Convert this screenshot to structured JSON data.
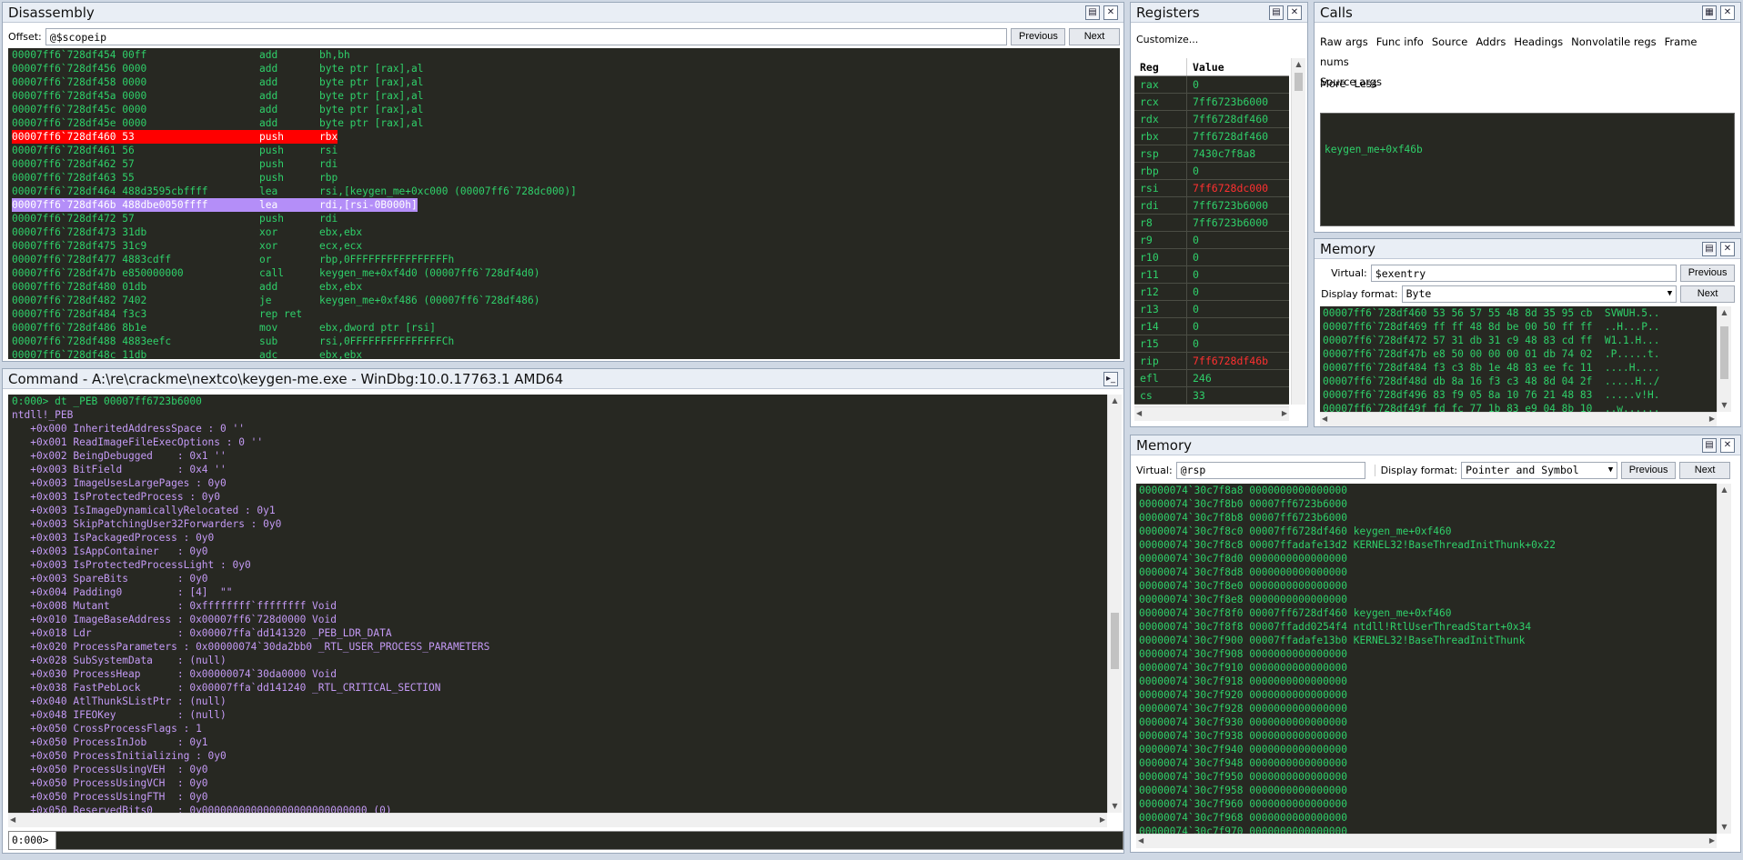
{
  "disassembly": {
    "title": "Disassembly",
    "offset_label": "Offset:",
    "offset_value": "@$scopeip",
    "prev": "Previous",
    "next": "Next",
    "lines": [
      [
        "00007ff6`728df454 00ff",
        "add",
        "bh,bh",
        ""
      ],
      [
        "00007ff6`728df456 0000",
        "add",
        "byte ptr [rax],al",
        ""
      ],
      [
        "00007ff6`728df458 0000",
        "add",
        "byte ptr [rax],al",
        ""
      ],
      [
        "00007ff6`728df45a 0000",
        "add",
        "byte ptr [rax],al",
        ""
      ],
      [
        "00007ff6`728df45c 0000",
        "add",
        "byte ptr [rax],al",
        ""
      ],
      [
        "00007ff6`728df45e 0000",
        "add",
        "byte ptr [rax],al",
        ""
      ],
      [
        "00007ff6`728df460 53",
        "push",
        "rbx",
        "red"
      ],
      [
        "00007ff6`728df461 56",
        "push",
        "rsi",
        ""
      ],
      [
        "00007ff6`728df462 57",
        "push",
        "rdi",
        ""
      ],
      [
        "00007ff6`728df463 55",
        "push",
        "rbp",
        ""
      ],
      [
        "00007ff6`728df464 488d3595cbffff",
        "lea",
        "rsi,[keygen_me+0xc000 (00007ff6`728dc000)]",
        ""
      ],
      [
        "00007ff6`728df46b 488dbe0050ffff",
        "lea",
        "rdi,[rsi-0B000h]",
        "purple"
      ],
      [
        "00007ff6`728df472 57",
        "push",
        "rdi",
        ""
      ],
      [
        "00007ff6`728df473 31db",
        "xor",
        "ebx,ebx",
        ""
      ],
      [
        "00007ff6`728df475 31c9",
        "xor",
        "ecx,ecx",
        ""
      ],
      [
        "00007ff6`728df477 4883cdff",
        "or",
        "rbp,0FFFFFFFFFFFFFFFFh",
        ""
      ],
      [
        "00007ff6`728df47b e850000000",
        "call",
        "keygen_me+0xf4d0 (00007ff6`728df4d0)",
        ""
      ],
      [
        "00007ff6`728df480 01db",
        "add",
        "ebx,ebx",
        ""
      ],
      [
        "00007ff6`728df482 7402",
        "je",
        "keygen_me+0xf486 (00007ff6`728df486)",
        ""
      ],
      [
        "00007ff6`728df484 f3c3",
        "rep ret",
        "",
        ""
      ],
      [
        "00007ff6`728df486 8b1e",
        "mov",
        "ebx,dword ptr [rsi]",
        ""
      ],
      [
        "00007ff6`728df488 4883eefc",
        "sub",
        "rsi,0FFFFFFFFFFFFFFFCh",
        ""
      ],
      [
        "00007ff6`728df48c 11db",
        "adc",
        "ebx,ebx",
        ""
      ]
    ]
  },
  "command": {
    "title": "Command - A:\\re\\crackme\\nextco\\keygen-me.exe - WinDbg:10.0.17763.1 AMD64",
    "prompt": "0:000>",
    "lines": [
      [
        "0:000> dt _PEB 00007ff6723b6000",
        "green"
      ],
      [
        "ntdll!_PEB",
        "purple"
      ],
      [
        "   +0x000 InheritedAddressSpace : 0 ''",
        "purple"
      ],
      [
        "   +0x001 ReadImageFileExecOptions : 0 ''",
        "purple"
      ],
      [
        "   +0x002 BeingDebugged    : 0x1 ''",
        "purple"
      ],
      [
        "   +0x003 BitField         : 0x4 ''",
        "purple"
      ],
      [
        "   +0x003 ImageUsesLargePages : 0y0",
        "purple"
      ],
      [
        "   +0x003 IsProtectedProcess : 0y0",
        "purple"
      ],
      [
        "   +0x003 IsImageDynamicallyRelocated : 0y1",
        "purple"
      ],
      [
        "   +0x003 SkipPatchingUser32Forwarders : 0y0",
        "purple"
      ],
      [
        "   +0x003 IsPackagedProcess : 0y0",
        "purple"
      ],
      [
        "   +0x003 IsAppContainer   : 0y0",
        "purple"
      ],
      [
        "   +0x003 IsProtectedProcessLight : 0y0",
        "purple"
      ],
      [
        "   +0x003 SpareBits        : 0y0",
        "purple"
      ],
      [
        "   +0x004 Padding0         : [4]  \"\"",
        "purple"
      ],
      [
        "   +0x008 Mutant           : 0xffffffff`ffffffff Void",
        "purple"
      ],
      [
        "   +0x010 ImageBaseAddress : 0x00007ff6`728d0000 Void",
        "purple"
      ],
      [
        "   +0x018 Ldr              : 0x00007ffa`dd141320 _PEB_LDR_DATA",
        "purple"
      ],
      [
        "   +0x020 ProcessParameters : 0x00000074`30da2bb0 _RTL_USER_PROCESS_PARAMETERS",
        "purple"
      ],
      [
        "   +0x028 SubSystemData    : (null)",
        "purple"
      ],
      [
        "   +0x030 ProcessHeap      : 0x00000074`30da0000 Void",
        "purple"
      ],
      [
        "   +0x038 FastPebLock      : 0x00007ffa`dd141240 _RTL_CRITICAL_SECTION",
        "purple"
      ],
      [
        "   +0x040 AtlThunkSListPtr : (null)",
        "purple"
      ],
      [
        "   +0x048 IFEOKey          : (null)",
        "purple"
      ],
      [
        "   +0x050 CrossProcessFlags : 1",
        "purple"
      ],
      [
        "   +0x050 ProcessInJob     : 0y1",
        "purple"
      ],
      [
        "   +0x050 ProcessInitializing : 0y0",
        "purple"
      ],
      [
        "   +0x050 ProcessUsingVEH  : 0y0",
        "purple"
      ],
      [
        "   +0x050 ProcessUsingVCH  : 0y0",
        "purple"
      ],
      [
        "   +0x050 ProcessUsingFTH  : 0y0",
        "purple"
      ],
      [
        "   +0x050 ReservedBits0    : 0y000000000000000000000000000 (0)",
        "purple"
      ]
    ]
  },
  "registers": {
    "title": "Registers",
    "customize": "Customize...",
    "col_reg": "Reg",
    "col_value": "Value",
    "rows": [
      [
        "rax",
        "0",
        ""
      ],
      [
        "rcx",
        "7ff6723b6000",
        ""
      ],
      [
        "rdx",
        "7ff6728df460",
        ""
      ],
      [
        "rbx",
        "7ff6728df460",
        ""
      ],
      [
        "rsp",
        "7430c7f8a8",
        ""
      ],
      [
        "rbp",
        "0",
        ""
      ],
      [
        "rsi",
        "7ff6728dc000",
        "red"
      ],
      [
        "rdi",
        "7ff6723b6000",
        ""
      ],
      [
        "r8",
        "7ff6723b6000",
        ""
      ],
      [
        "r9",
        "0",
        ""
      ],
      [
        "r10",
        "0",
        ""
      ],
      [
        "r11",
        "0",
        ""
      ],
      [
        "r12",
        "0",
        ""
      ],
      [
        "r13",
        "0",
        ""
      ],
      [
        "r14",
        "0",
        ""
      ],
      [
        "r15",
        "0",
        ""
      ],
      [
        "rip",
        "7ff6728df46b",
        "red"
      ],
      [
        "efl",
        "246",
        ""
      ],
      [
        "cs",
        "33",
        ""
      ]
    ]
  },
  "calls": {
    "title": "Calls",
    "links": [
      "Raw args",
      "Func info",
      "Source",
      "Addrs",
      "Headings",
      "Nonvolatile regs",
      "Frame nums",
      "Source args"
    ],
    "more": "More",
    "less": "Less",
    "entry": "keygen_me+0xf46b"
  },
  "memory1": {
    "title": "Memory",
    "virtual_label": "Virtual:",
    "virtual_value": "$exentry",
    "format_label": "Display format:",
    "format_value": "Byte",
    "prev": "Previous",
    "next": "Next",
    "lines": [
      "00007ff6`728df460 53 56 57 55 48 8d 35 95 cb  SVWUH.5..",
      "00007ff6`728df469 ff ff 48 8d be 00 50 ff ff  ..H...P..",
      "00007ff6`728df472 57 31 db 31 c9 48 83 cd ff  W1.1.H...",
      "00007ff6`728df47b e8 50 00 00 00 01 db 74 02  .P.....t.",
      "00007ff6`728df484 f3 c3 8b 1e 48 83 ee fc 11  ....H....",
      "00007ff6`728df48d db 8a 16 f3 c3 48 8d 04 2f  .....H../",
      "00007ff6`728df496 83 f9 05 8a 10 76 21 48 83  .....v!H.",
      "00007ff6`728df49f fd fc 77 1b 83 e9 04 8b 10  ..w......"
    ]
  },
  "memory2": {
    "title": "Memory",
    "virtual_label": "Virtual:",
    "virtual_value": "@rsp",
    "format_label": "Display format:",
    "format_value": "Pointer and Symbol",
    "prev": "Previous",
    "next": "Next",
    "lines": [
      "00000074`30c7f8a8 0000000000000000",
      "00000074`30c7f8b0 00007ff6723b6000",
      "00000074`30c7f8b8 00007ff6723b6000",
      "00000074`30c7f8c0 00007ff6728df460 keygen_me+0xf460",
      "00000074`30c7f8c8 00007ffadafe13d2 KERNEL32!BaseThreadInitThunk+0x22",
      "00000074`30c7f8d0 0000000000000000",
      "00000074`30c7f8d8 0000000000000000",
      "00000074`30c7f8e0 0000000000000000",
      "00000074`30c7f8e8 0000000000000000",
      "00000074`30c7f8f0 00007ff6728df460 keygen_me+0xf460",
      "00000074`30c7f8f8 00007ffadd0254f4 ntdll!RtlUserThreadStart+0x34",
      "00000074`30c7f900 00007ffadafe13b0 KERNEL32!BaseThreadInitThunk",
      "00000074`30c7f908 0000000000000000",
      "00000074`30c7f910 0000000000000000",
      "00000074`30c7f918 0000000000000000",
      "00000074`30c7f920 0000000000000000",
      "00000074`30c7f928 0000000000000000",
      "00000074`30c7f930 0000000000000000",
      "00000074`30c7f938 0000000000000000",
      "00000074`30c7f940 0000000000000000",
      "00000074`30c7f948 0000000000000000",
      "00000074`30c7f950 0000000000000000",
      "00000074`30c7f958 0000000000000000",
      "00000074`30c7f960 0000000000000000",
      "00000074`30c7f968 0000000000000000",
      "00000074`30c7f970 0000000000000000"
    ]
  },
  "colors": {
    "green": "#2fd06a",
    "purple": "#c49af5",
    "bg": "#272822",
    "red_highlight": "#ff0000",
    "purple_highlight": "#b48ef8"
  }
}
